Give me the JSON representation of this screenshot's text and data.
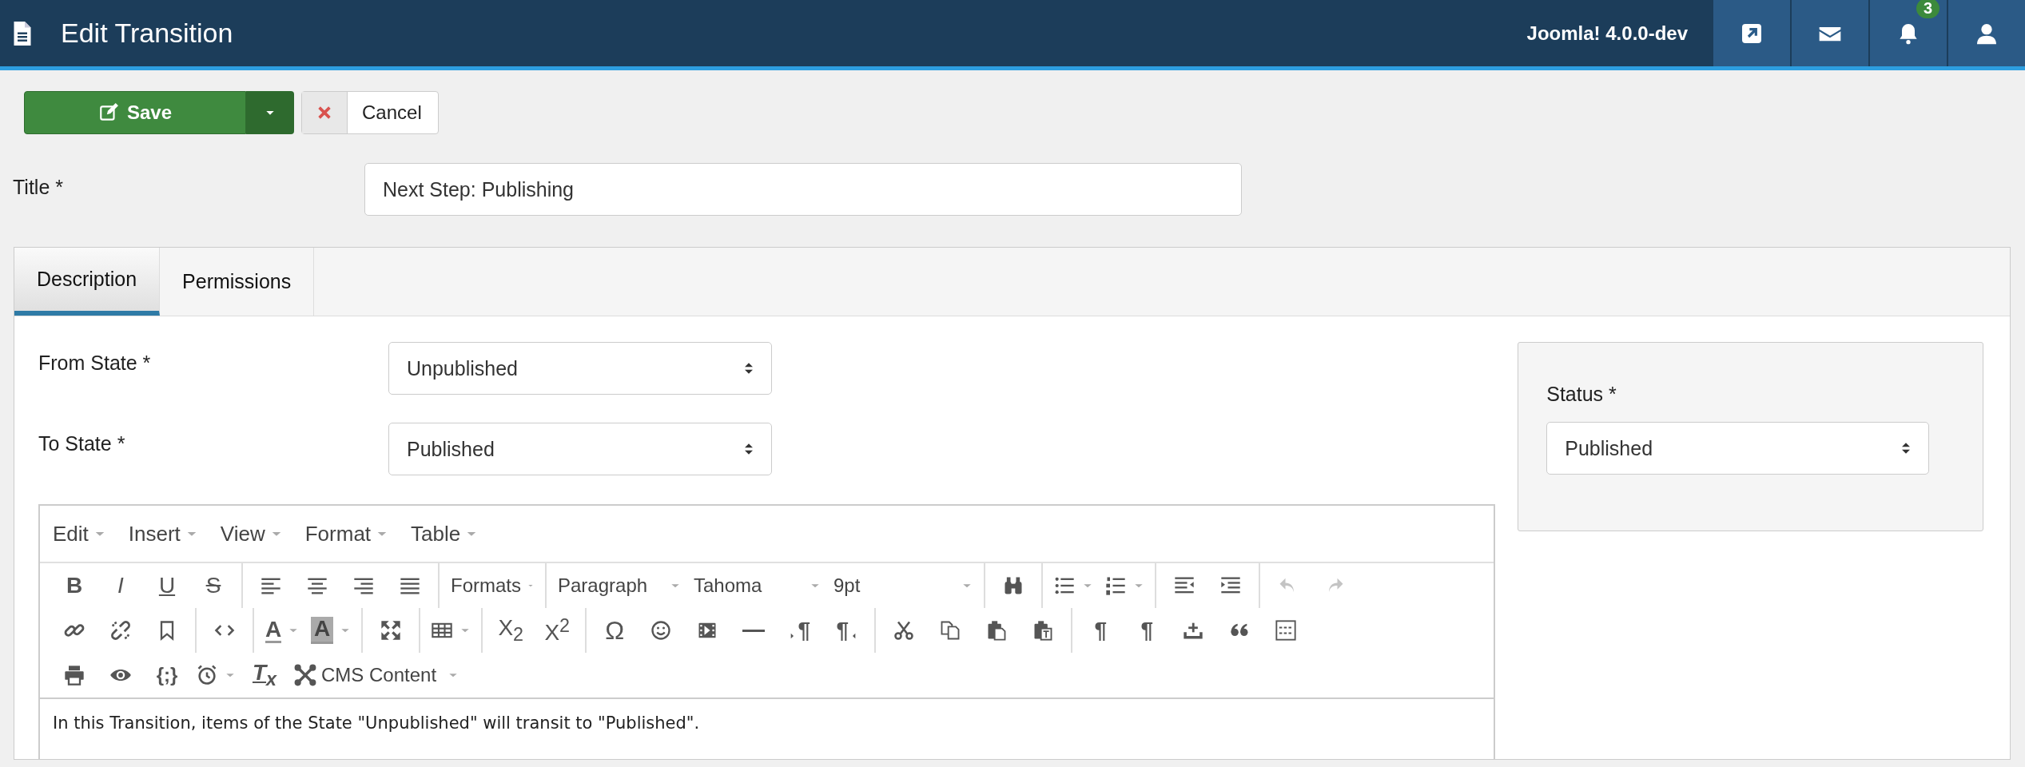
{
  "header": {
    "title": "Edit Transition",
    "version": "Joomla! 4.0.0-dev",
    "notifications_badge": "3"
  },
  "actions": {
    "save": "Save",
    "cancel": "Cancel"
  },
  "title_field": {
    "label": "Title *",
    "value": "Next Step: Publishing"
  },
  "tabs": [
    {
      "label": "Description",
      "selected": true
    },
    {
      "label": "Permissions",
      "selected": false
    }
  ],
  "from_state": {
    "label": "From State *",
    "value": "Unpublished"
  },
  "to_state": {
    "label": "To State *",
    "value": "Published"
  },
  "status": {
    "label": "Status *",
    "value": "Published"
  },
  "editor": {
    "menus": [
      "Edit",
      "Insert",
      "View",
      "Format",
      "Table"
    ],
    "toolbar": {
      "bold": "B",
      "italic": "I",
      "underline": "U",
      "strikethrough": "S",
      "formats": "Formats",
      "block": "Paragraph",
      "font": "Tahoma",
      "size": "9pt",
      "undo": {
        "disabled": true
      },
      "redo": {
        "disabled": true
      },
      "text_color": "A",
      "highlight": "A",
      "subscript": "X$_{2}$",
      "superscript": "X$^{2}$",
      "special_char": "Ω",
      "ltr": "¶",
      "rtl": "¶",
      "visual_chars": "¶",
      "visual_blocks": "¶",
      "code_sample": "{;}",
      "clear_format": "T$_{x}$",
      "cms_content": "CMS Content"
    },
    "content": "In this Transition, items of the State \"Unpublished\" will transit to \"Published\"."
  }
}
